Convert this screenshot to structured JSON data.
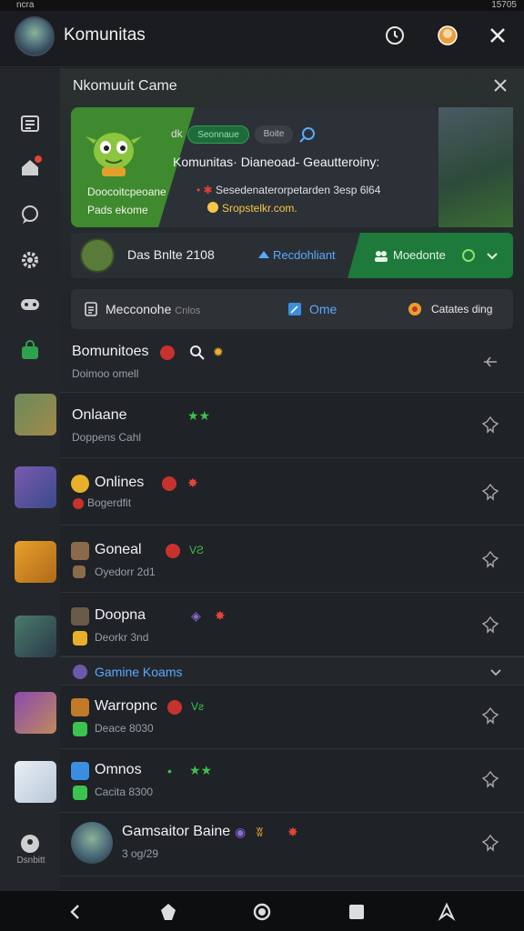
{
  "status_bar": {
    "left": "ncra",
    "right": "15705"
  },
  "app_bar": {
    "title": "Komunitas"
  },
  "panel": {
    "title": "Nkomuuit Came",
    "hero": {
      "subtitle_1": "Doocoitcpeoane",
      "subtitle_2": "Pads ekome",
      "dk_label": "dk",
      "tag_1": "Seonnaue",
      "tag_2": "Boite",
      "heading": "Komunitas·  Dianeoad-  Geautteroiny:",
      "detail": "Sesedenaterorpetarden 3esp 6l64",
      "email": "Sropstelkr.com."
    },
    "promo": {
      "title": "Das Bnlte 2108",
      "link": "Recdohliant",
      "moderation": "Moedonte"
    },
    "filter": {
      "item_1": "Mecconohe",
      "item_1_hint": "Cnlos",
      "item_2": "Ome",
      "item_3": "Catates ding"
    }
  },
  "list": [
    {
      "title": "Bomunitoes",
      "sub": "Doimoo omell"
    },
    {
      "title": "Onlaane",
      "sub": "Doppens Cahl"
    },
    {
      "title": "Onlines",
      "sub": "Bogerdfit"
    },
    {
      "title": "Goneal",
      "sub": "Oyedorr 2d1"
    },
    {
      "title": "Doopna",
      "sub": "Deorkr 3nd"
    },
    {
      "title": "Warropnc",
      "sub": "Deace 8030"
    },
    {
      "title": "Omnos",
      "sub": "Cacita 8300"
    },
    {
      "title": "Gamsaitor Baine",
      "sub": "3 og/29"
    }
  ],
  "section": {
    "title": "Gamine Koams"
  },
  "sidebar": {
    "bottom_label": "Dsnbitt"
  },
  "colors": {
    "accent_green": "#3f8a2e",
    "link_blue": "#5aa9ff",
    "badge_red": "#c8322e",
    "background": "#1d1f23"
  },
  "icons": [
    "clock-icon",
    "profile-icon",
    "close-icon",
    "list-icon",
    "home-icon",
    "chat-icon",
    "gear-icon",
    "gamepad-icon",
    "store-icon",
    "back-icon",
    "home-nav-icon",
    "recent-icon",
    "assistant-icon",
    "pin-icon"
  ]
}
